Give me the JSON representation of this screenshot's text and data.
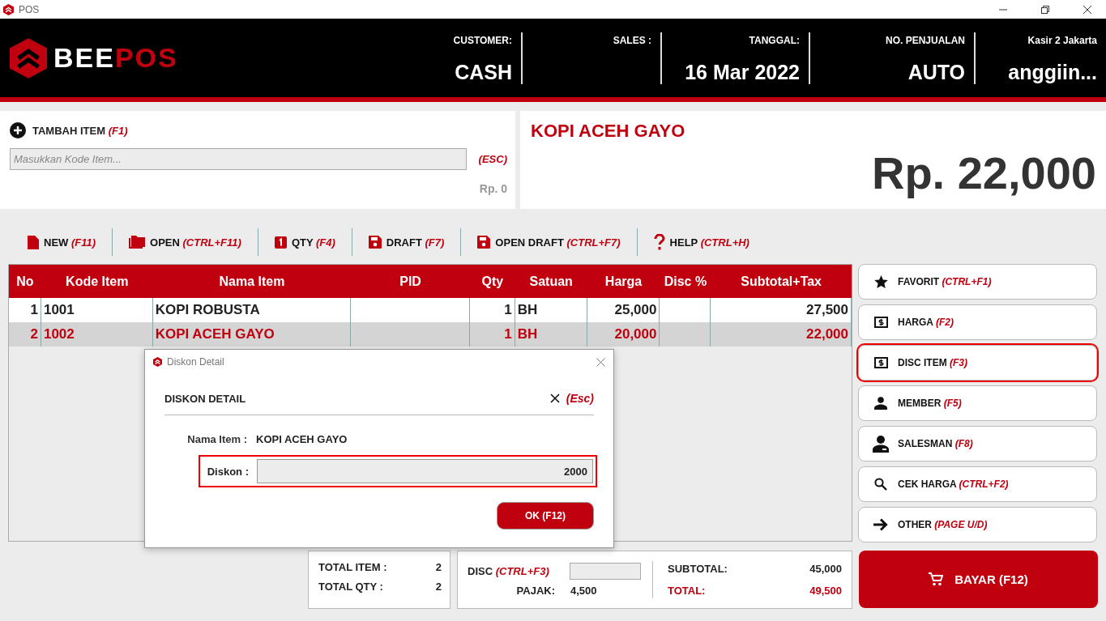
{
  "window": {
    "title": "POS"
  },
  "logo": {
    "parts": [
      {
        "text": "BEE",
        "color": "#ffffff"
      },
      {
        "text": "POS",
        "color": "#c0000f"
      }
    ]
  },
  "header_fields": [
    {
      "label": "CUSTOMER:",
      "value": "CASH"
    },
    {
      "label": "SALES :"
    },
    {
      "label": "TANGGAL:",
      "value": "16 Mar 2022"
    },
    {
      "label": "NO. PENJUALAN",
      "value": "AUTO"
    },
    {
      "label": "Kasir 2 Jakarta",
      "value": "anggiin..."
    }
  ],
  "add_item": {
    "title": "TAMBAH ITEM",
    "hotkey": "(F1)",
    "placeholder": "Masukkan Kode Item...",
    "esc_hint": "(ESC)",
    "price": "Rp. 0"
  },
  "display": {
    "item_name": "KOPI ACEH GAYO",
    "amount": "Rp. 22,000"
  },
  "toolbar": [
    {
      "kind": "file",
      "label": "NEW",
      "hotkey": "(F11)"
    },
    {
      "kind": "folder",
      "label": "OPEN",
      "hotkey": "(CTRL+F11)"
    },
    {
      "kind": "qty",
      "label": "QTY",
      "hotkey": "(F4)"
    },
    {
      "kind": "save",
      "label": "DRAFT",
      "hotkey": "(F7)"
    },
    {
      "kind": "save",
      "label": "OPEN DRAFT",
      "hotkey": "(CTRL+F7)"
    },
    {
      "kind": "help",
      "label": "HELP",
      "hotkey": "(CTRL+H)"
    }
  ],
  "table": {
    "columns": [
      "No",
      "Kode Item",
      "Nama Item",
      "PID",
      "Qty",
      "Satuan",
      "Harga",
      "Disc %",
      "Subtotal+Tax"
    ],
    "rows": [
      {
        "selected": false,
        "cells": [
          "1",
          "1001",
          "KOPI ROBUSTA",
          "",
          "1",
          "BH",
          "25,000",
          "",
          "27,500"
        ]
      },
      {
        "selected": true,
        "cells": [
          "2",
          "1002",
          "KOPI ACEH GAYO",
          "",
          "1",
          "BH",
          "20,000",
          "",
          "22,000"
        ]
      }
    ]
  },
  "side_buttons": [
    {
      "kind": "star",
      "label": "FAVORIT",
      "hotkey": "(CTRL+F1)",
      "highlighted": false
    },
    {
      "kind": "bill",
      "label": "HARGA",
      "hotkey": "(F2)",
      "highlighted": false
    },
    {
      "kind": "bill",
      "label": "DISC ITEM",
      "hotkey": "(F3)",
      "highlighted": true
    },
    {
      "kind": "person",
      "label": "MEMBER",
      "hotkey": "(F5)",
      "highlighted": false
    },
    {
      "kind": "salesman",
      "label": "SALESMAN",
      "hotkey": "(F8)",
      "highlighted": false
    },
    {
      "kind": "search",
      "label": "CEK HARGA",
      "hotkey": "(CTRL+F2)",
      "highlighted": false
    },
    {
      "kind": "arrow",
      "label": "OTHER",
      "hotkey": "(PAGE U/D)",
      "highlighted": false
    }
  ],
  "totals": {
    "total_item_label": "TOTAL ITEM :",
    "total_item": "2",
    "total_qty_label": "TOTAL QTY :",
    "total_qty": "2",
    "disc_label": "DISC",
    "disc_hotkey": "(CTRL+F3)",
    "pajak_label": "PAJAK:",
    "pajak": "4,500",
    "subtotal_label": "SUBTOTAL:",
    "subtotal": "45,000",
    "total_label": "TOTAL:",
    "total": "49,500"
  },
  "pay_button": {
    "label": "BAYAR (F12)"
  },
  "dialog": {
    "title": "Diskon Detail",
    "heading": "DISKON DETAIL",
    "esc_hint": "(Esc)",
    "name_label": "Nama Item :",
    "name_value": "KOPI ACEH GAYO",
    "discount_label": "Diskon :",
    "discount_value": "2000",
    "discount_highlighted": true,
    "ok_button": "OK (F12)"
  }
}
